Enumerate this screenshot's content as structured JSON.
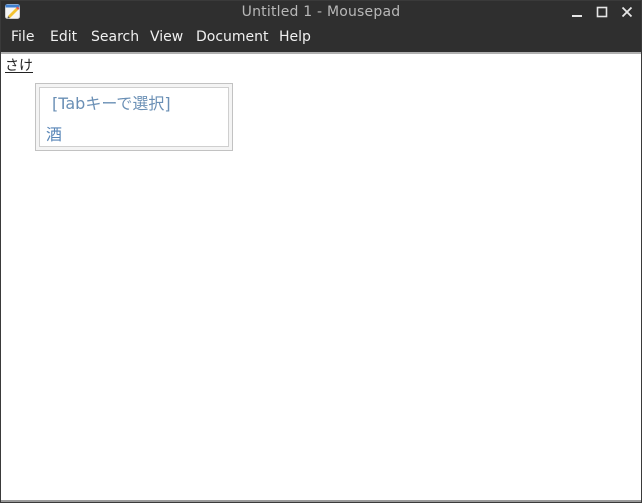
{
  "window": {
    "title": "Untitled 1 - Mousepad",
    "app_icon": "mousepad-icon",
    "controls": [
      "minimize-icon",
      "maximize-icon",
      "close-icon"
    ]
  },
  "menubar": {
    "items": [
      {
        "label": "File"
      },
      {
        "label": "Edit"
      },
      {
        "label": "Search"
      },
      {
        "label": "View"
      },
      {
        "label": "Document"
      },
      {
        "label": "Help"
      }
    ]
  },
  "editor": {
    "preedit_text": "さけ"
  },
  "ime_popup": {
    "hint": "[Tabキーで選択]",
    "candidates": [
      "酒"
    ]
  },
  "colors": {
    "titlebar_bg": "#2f2f2f",
    "menu_text": "#f0f0f0",
    "ime_text": "#5a87b8"
  }
}
